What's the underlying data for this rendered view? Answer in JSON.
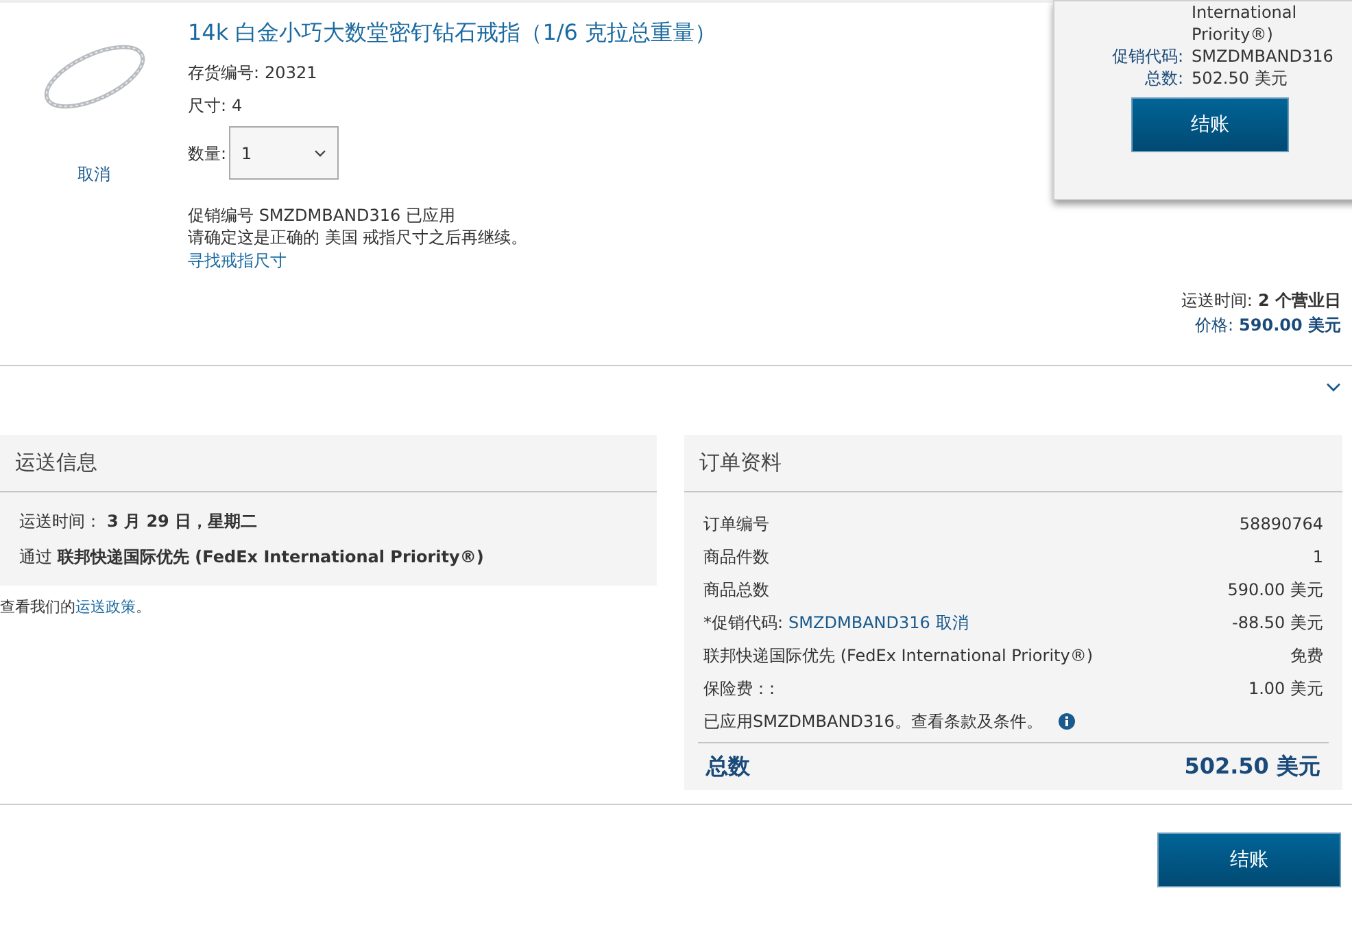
{
  "product": {
    "title": "14k 白金小巧大数堂密钉钻石戒指（1/6 克拉总重量）",
    "sku_label": "存货编号:",
    "sku": "20321",
    "size_label": "尺寸:",
    "size": "4",
    "quantity_label": "数量:",
    "quantity": "1",
    "cancel": "取消",
    "promo_line": "促销编号 SMZDMBAND316 已应用",
    "confirm_line": "请确定这是正确的 美国 戒指尺寸之后再继续。",
    "find_size_link": "寻找戒指尺寸",
    "shipping_label": "运送时间:",
    "shipping_value": "2 个营业日",
    "price_label": "价格:",
    "price_value": "590.00 美元"
  },
  "popup": {
    "rows": [
      {
        "label": "",
        "value": "International Priority®)"
      },
      {
        "label": "促销代码:",
        "value": "SMZDMBAND316"
      },
      {
        "label": "总数:",
        "value": "502.50 美元"
      }
    ],
    "button": "结账"
  },
  "shipping_info": {
    "title": "运送信息",
    "time_label": "运送时间：",
    "time_value": "3 月 29 日，星期二",
    "method_label": "通过",
    "method_value": "联邦快递国际优先 (FedEx International Priority®)",
    "policy_prefix": "查看我们的",
    "policy_link": "运送政策",
    "policy_suffix": "。"
  },
  "order_summary": {
    "title": "订单资料",
    "rows": [
      {
        "kind": "plain",
        "label": "订单编号",
        "value": "58890764"
      },
      {
        "kind": "plain",
        "label": "商品件数",
        "value": "1"
      },
      {
        "kind": "plain",
        "label": "商品总数",
        "value": "590.00 美元"
      },
      {
        "kind": "promo",
        "label": "*促销代码:",
        "code": "SMZDMBAND316",
        "link": "取消",
        "value": "-88.50 美元"
      },
      {
        "kind": "plain",
        "label": "联邦快递国际优先 (FedEx International Priority®)",
        "value": "免费"
      },
      {
        "kind": "plain",
        "label": "保险费：:",
        "value": "1.00 美元"
      },
      {
        "kind": "note",
        "label": "已应用SMZDMBAND316。查看条款及条件。"
      }
    ],
    "total_label": "总数",
    "total_value": "502.50 美元"
  },
  "checkout_button": "结账"
}
